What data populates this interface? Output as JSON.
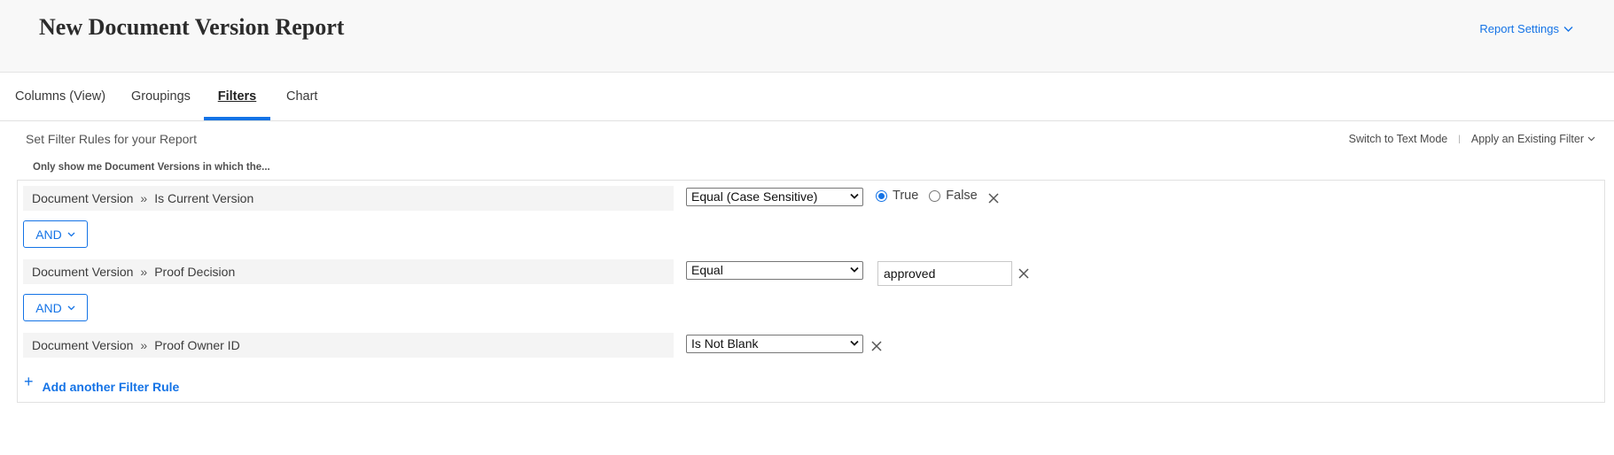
{
  "header": {
    "title": "New Document Version Report",
    "settings_label": "Report Settings"
  },
  "tabs": [
    {
      "label": "Columns (View)",
      "active": false
    },
    {
      "label": "Groupings",
      "active": false
    },
    {
      "label": "Filters",
      "active": true
    },
    {
      "label": "Chart",
      "active": false
    }
  ],
  "filters": {
    "section_title": "Set Filter Rules for your Report",
    "switch_text_mode": "Switch to Text Mode",
    "apply_existing": "Apply an Existing Filter",
    "intro": "Only show me Document Versions in which the...",
    "rules": [
      {
        "object": "Document Version",
        "field": "Is Current Version",
        "operator": "Equal (Case Sensitive)",
        "options": [
          {
            "label": "True",
            "checked": true
          },
          {
            "label": "False",
            "checked": false
          }
        ]
      },
      {
        "object": "Document Version",
        "field": "Proof Decision",
        "operator": "Equal",
        "value": "approved"
      },
      {
        "object": "Document Version",
        "field": "Proof Owner ID",
        "operator": "Is Not Blank"
      }
    ],
    "connectors": [
      "AND",
      "AND"
    ],
    "add_rule_label": "Add another Filter Rule"
  },
  "colors": {
    "accent": "#1473e6",
    "header_bg": "#f8f8f8"
  }
}
